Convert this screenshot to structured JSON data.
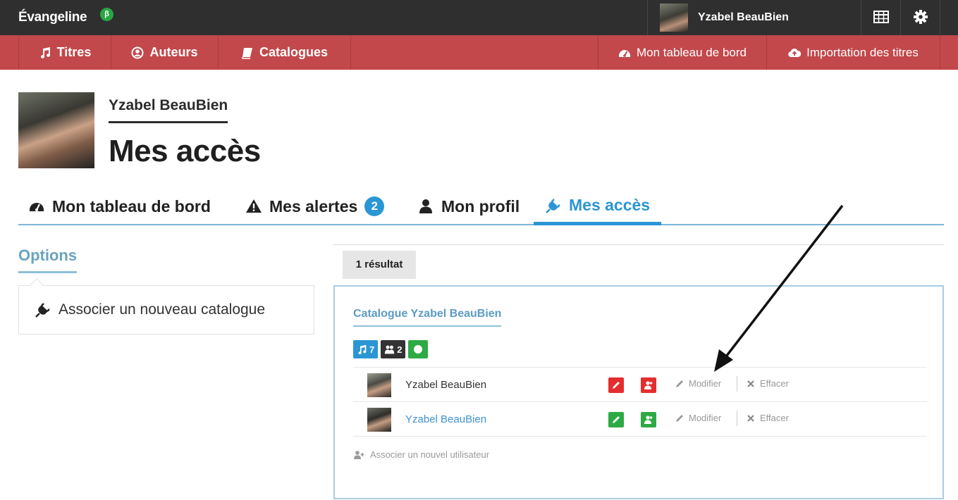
{
  "topbar": {
    "brand": "Évangeline",
    "beta_badge": "β",
    "username": "Yzabel BeauBien",
    "grid_icon": "table-grid-icon",
    "settings_icon": "gear-icon"
  },
  "nav": {
    "left": [
      {
        "label": "Titres",
        "icon": "music-note-icon"
      },
      {
        "label": "Auteurs",
        "icon": "user-circle-icon"
      },
      {
        "label": "Catalogues",
        "icon": "book-icon"
      }
    ],
    "right": [
      {
        "label": "Mon tableau de bord",
        "icon": "dashboard-icon"
      },
      {
        "label": "Importation des titres",
        "icon": "cloud-upload-icon"
      }
    ]
  },
  "profile": {
    "name": "Yzabel BeauBien",
    "page_title": "Mes accès"
  },
  "tabs": [
    {
      "label": "Mon tableau de bord",
      "icon": "dashboard-icon"
    },
    {
      "label": "Mes alertes",
      "icon": "warning-icon",
      "badge": "2"
    },
    {
      "label": "Mon profil",
      "icon": "user-icon"
    },
    {
      "label": "Mes accès",
      "icon": "plug-icon",
      "active": true
    }
  ],
  "options": {
    "title": "Options",
    "item": "Associer un nouveau catalogue"
  },
  "results": {
    "count_label": "1 résultat",
    "catalog": {
      "title": "Catalogue Yzabel BeauBien",
      "pills": [
        {
          "icon": "music-note-icon",
          "value": "7",
          "color": "#2a96d4"
        },
        {
          "icon": "users-icon",
          "value": "2",
          "color": "#333333"
        },
        {
          "icon": "circle-icon",
          "value": "",
          "color": "#2eaa44"
        }
      ],
      "rows": [
        {
          "name": "Yzabel BeauBien",
          "linked": false,
          "permission_color": "#e52d2d",
          "edit": "Modifier",
          "delete": "Effacer"
        },
        {
          "name": "Yzabel BeauBien",
          "linked": true,
          "permission_color": "#2eaa44",
          "edit": "Modifier",
          "delete": "Effacer"
        }
      ],
      "add_user": "Associer un nouvel utilisateur"
    }
  },
  "colors": {
    "topbar": "#2f2f2f",
    "navbar": "#c2484b",
    "accent": "#2a96d4",
    "danger": "#e52d2d",
    "success": "#2eaa44"
  }
}
